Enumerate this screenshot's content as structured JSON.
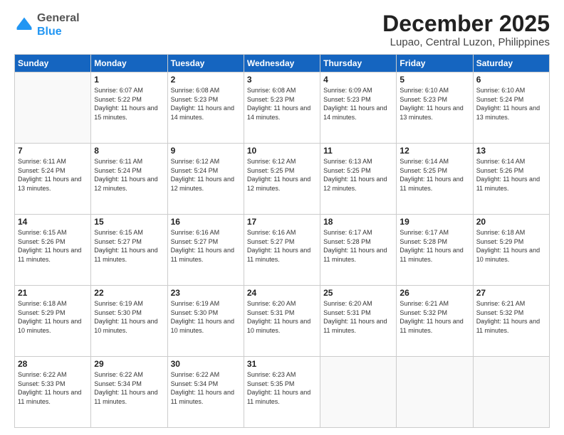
{
  "logo": {
    "general": "General",
    "blue": "Blue"
  },
  "title": "December 2025",
  "subtitle": "Lupao, Central Luzon, Philippines",
  "weekdays": [
    "Sunday",
    "Monday",
    "Tuesday",
    "Wednesday",
    "Thursday",
    "Friday",
    "Saturday"
  ],
  "weeks": [
    [
      {
        "day": "",
        "sunrise": "",
        "sunset": "",
        "daylight": ""
      },
      {
        "day": "1",
        "sunrise": "Sunrise: 6:07 AM",
        "sunset": "Sunset: 5:22 PM",
        "daylight": "Daylight: 11 hours and 15 minutes."
      },
      {
        "day": "2",
        "sunrise": "Sunrise: 6:08 AM",
        "sunset": "Sunset: 5:23 PM",
        "daylight": "Daylight: 11 hours and 14 minutes."
      },
      {
        "day": "3",
        "sunrise": "Sunrise: 6:08 AM",
        "sunset": "Sunset: 5:23 PM",
        "daylight": "Daylight: 11 hours and 14 minutes."
      },
      {
        "day": "4",
        "sunrise": "Sunrise: 6:09 AM",
        "sunset": "Sunset: 5:23 PM",
        "daylight": "Daylight: 11 hours and 14 minutes."
      },
      {
        "day": "5",
        "sunrise": "Sunrise: 6:10 AM",
        "sunset": "Sunset: 5:23 PM",
        "daylight": "Daylight: 11 hours and 13 minutes."
      },
      {
        "day": "6",
        "sunrise": "Sunrise: 6:10 AM",
        "sunset": "Sunset: 5:24 PM",
        "daylight": "Daylight: 11 hours and 13 minutes."
      }
    ],
    [
      {
        "day": "7",
        "sunrise": "Sunrise: 6:11 AM",
        "sunset": "Sunset: 5:24 PM",
        "daylight": "Daylight: 11 hours and 13 minutes."
      },
      {
        "day": "8",
        "sunrise": "Sunrise: 6:11 AM",
        "sunset": "Sunset: 5:24 PM",
        "daylight": "Daylight: 11 hours and 12 minutes."
      },
      {
        "day": "9",
        "sunrise": "Sunrise: 6:12 AM",
        "sunset": "Sunset: 5:24 PM",
        "daylight": "Daylight: 11 hours and 12 minutes."
      },
      {
        "day": "10",
        "sunrise": "Sunrise: 6:12 AM",
        "sunset": "Sunset: 5:25 PM",
        "daylight": "Daylight: 11 hours and 12 minutes."
      },
      {
        "day": "11",
        "sunrise": "Sunrise: 6:13 AM",
        "sunset": "Sunset: 5:25 PM",
        "daylight": "Daylight: 11 hours and 12 minutes."
      },
      {
        "day": "12",
        "sunrise": "Sunrise: 6:14 AM",
        "sunset": "Sunset: 5:25 PM",
        "daylight": "Daylight: 11 hours and 11 minutes."
      },
      {
        "day": "13",
        "sunrise": "Sunrise: 6:14 AM",
        "sunset": "Sunset: 5:26 PM",
        "daylight": "Daylight: 11 hours and 11 minutes."
      }
    ],
    [
      {
        "day": "14",
        "sunrise": "Sunrise: 6:15 AM",
        "sunset": "Sunset: 5:26 PM",
        "daylight": "Daylight: 11 hours and 11 minutes."
      },
      {
        "day": "15",
        "sunrise": "Sunrise: 6:15 AM",
        "sunset": "Sunset: 5:27 PM",
        "daylight": "Daylight: 11 hours and 11 minutes."
      },
      {
        "day": "16",
        "sunrise": "Sunrise: 6:16 AM",
        "sunset": "Sunset: 5:27 PM",
        "daylight": "Daylight: 11 hours and 11 minutes."
      },
      {
        "day": "17",
        "sunrise": "Sunrise: 6:16 AM",
        "sunset": "Sunset: 5:27 PM",
        "daylight": "Daylight: 11 hours and 11 minutes."
      },
      {
        "day": "18",
        "sunrise": "Sunrise: 6:17 AM",
        "sunset": "Sunset: 5:28 PM",
        "daylight": "Daylight: 11 hours and 11 minutes."
      },
      {
        "day": "19",
        "sunrise": "Sunrise: 6:17 AM",
        "sunset": "Sunset: 5:28 PM",
        "daylight": "Daylight: 11 hours and 11 minutes."
      },
      {
        "day": "20",
        "sunrise": "Sunrise: 6:18 AM",
        "sunset": "Sunset: 5:29 PM",
        "daylight": "Daylight: 11 hours and 10 minutes."
      }
    ],
    [
      {
        "day": "21",
        "sunrise": "Sunrise: 6:18 AM",
        "sunset": "Sunset: 5:29 PM",
        "daylight": "Daylight: 11 hours and 10 minutes."
      },
      {
        "day": "22",
        "sunrise": "Sunrise: 6:19 AM",
        "sunset": "Sunset: 5:30 PM",
        "daylight": "Daylight: 11 hours and 10 minutes."
      },
      {
        "day": "23",
        "sunrise": "Sunrise: 6:19 AM",
        "sunset": "Sunset: 5:30 PM",
        "daylight": "Daylight: 11 hours and 10 minutes."
      },
      {
        "day": "24",
        "sunrise": "Sunrise: 6:20 AM",
        "sunset": "Sunset: 5:31 PM",
        "daylight": "Daylight: 11 hours and 10 minutes."
      },
      {
        "day": "25",
        "sunrise": "Sunrise: 6:20 AM",
        "sunset": "Sunset: 5:31 PM",
        "daylight": "Daylight: 11 hours and 11 minutes."
      },
      {
        "day": "26",
        "sunrise": "Sunrise: 6:21 AM",
        "sunset": "Sunset: 5:32 PM",
        "daylight": "Daylight: 11 hours and 11 minutes."
      },
      {
        "day": "27",
        "sunrise": "Sunrise: 6:21 AM",
        "sunset": "Sunset: 5:32 PM",
        "daylight": "Daylight: 11 hours and 11 minutes."
      }
    ],
    [
      {
        "day": "28",
        "sunrise": "Sunrise: 6:22 AM",
        "sunset": "Sunset: 5:33 PM",
        "daylight": "Daylight: 11 hours and 11 minutes."
      },
      {
        "day": "29",
        "sunrise": "Sunrise: 6:22 AM",
        "sunset": "Sunset: 5:34 PM",
        "daylight": "Daylight: 11 hours and 11 minutes."
      },
      {
        "day": "30",
        "sunrise": "Sunrise: 6:22 AM",
        "sunset": "Sunset: 5:34 PM",
        "daylight": "Daylight: 11 hours and 11 minutes."
      },
      {
        "day": "31",
        "sunrise": "Sunrise: 6:23 AM",
        "sunset": "Sunset: 5:35 PM",
        "daylight": "Daylight: 11 hours and 11 minutes."
      },
      {
        "day": "",
        "sunrise": "",
        "sunset": "",
        "daylight": ""
      },
      {
        "day": "",
        "sunrise": "",
        "sunset": "",
        "daylight": ""
      },
      {
        "day": "",
        "sunrise": "",
        "sunset": "",
        "daylight": ""
      }
    ]
  ]
}
